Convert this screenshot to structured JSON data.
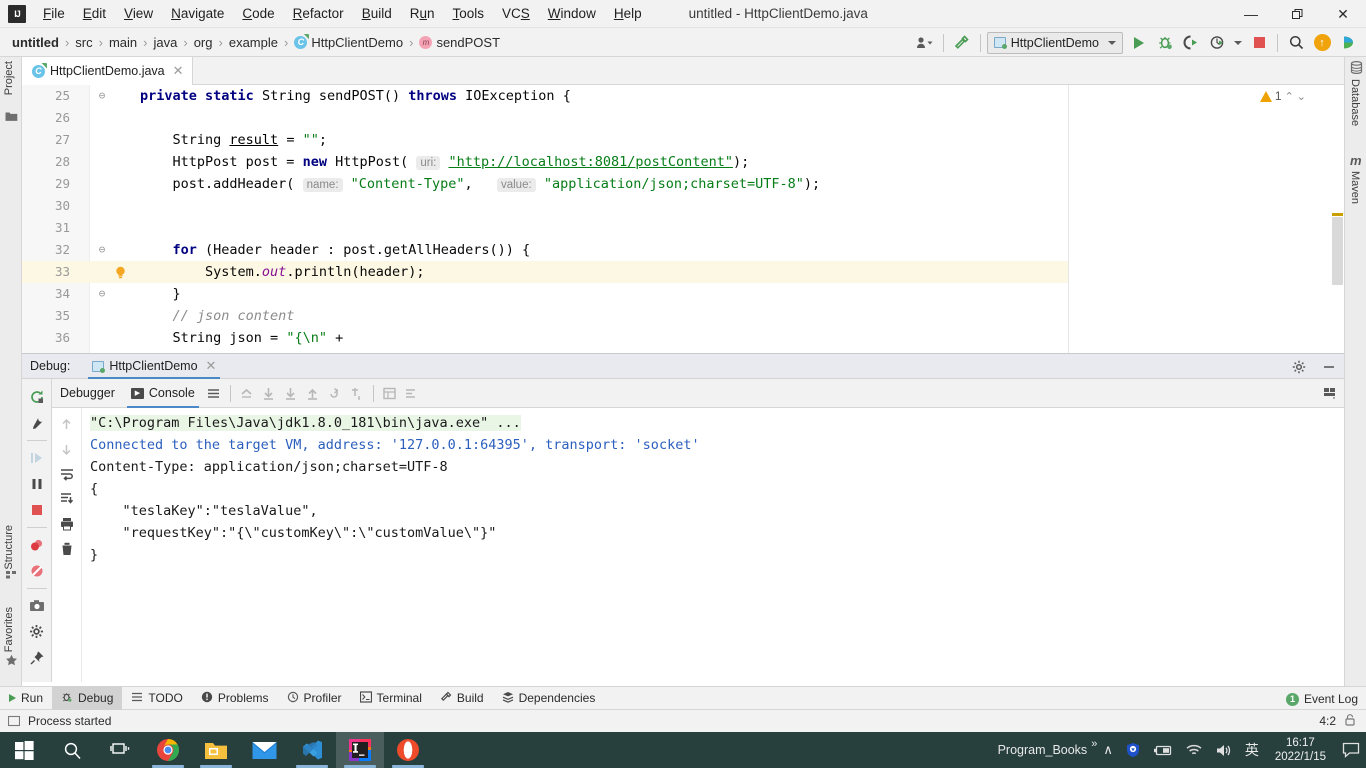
{
  "window": {
    "title": "untitled - HttpClientDemo.java",
    "minimize": "—",
    "maximize": "❐",
    "close": "✕"
  },
  "menu": {
    "items": [
      {
        "label": "File"
      },
      {
        "label": "Edit"
      },
      {
        "label": "View"
      },
      {
        "label": "Navigate"
      },
      {
        "label": "Code"
      },
      {
        "label": "Refactor"
      },
      {
        "label": "Build"
      },
      {
        "label": "Run"
      },
      {
        "label": "Tools"
      },
      {
        "label": "VCS"
      },
      {
        "label": "Window"
      },
      {
        "label": "Help"
      }
    ]
  },
  "navbar": {
    "crumbs": [
      {
        "label": "untitled"
      },
      {
        "label": "src"
      },
      {
        "label": "main"
      },
      {
        "label": "java"
      },
      {
        "label": "org"
      },
      {
        "label": "example"
      },
      {
        "label": "HttpClientDemo"
      },
      {
        "label": "sendPOST"
      }
    ],
    "separator": "›",
    "run_config": "HttpClientDemo",
    "icons": {
      "user": "user-settings-icon",
      "build": "hammer-icon",
      "run": "run-icon",
      "debug": "debug-icon",
      "coverage": "run-with-coverage-icon",
      "profile": "profiler-icon",
      "stop": "stop-icon",
      "search": "search-everywhere-icon",
      "update": "update-project-icon",
      "share": "share-icon"
    }
  },
  "left_stripe": {
    "project": "Project",
    "structure": "Structure",
    "favorites": "Favorites"
  },
  "right_stripe": {
    "database": "Database",
    "maven": "Maven"
  },
  "editor": {
    "tab": "HttpClientDemo.java",
    "tab_close": "✕",
    "warning_count": "1",
    "chevron_up": "⌃",
    "chevron_down": "⌄",
    "lines": [
      {
        "num": "25",
        "fold": "⊖",
        "segments": [
          {
            "t": "private ",
            "c": "kw"
          },
          {
            "t": "static ",
            "c": "kw"
          },
          {
            "t": "String sendPOST() ",
            "c": "plain"
          },
          {
            "t": "throws ",
            "c": "kw"
          },
          {
            "t": "IOException {",
            "c": "plain"
          }
        ]
      },
      {
        "num": "26",
        "fold": "",
        "segments": []
      },
      {
        "num": "27",
        "fold": "",
        "segments": [
          {
            "t": "    String ",
            "c": "plain"
          },
          {
            "t": "result",
            "c": "uline"
          },
          {
            "t": " = ",
            "c": "plain"
          },
          {
            "t": "\"\"",
            "c": "str"
          },
          {
            "t": ";",
            "c": "plain"
          }
        ]
      },
      {
        "num": "28",
        "fold": "",
        "segments": [
          {
            "t": "    HttpPost post = ",
            "c": "plain"
          },
          {
            "t": "new ",
            "c": "kw"
          },
          {
            "t": "HttpPost( ",
            "c": "plain"
          },
          {
            "t": "uri:",
            "c": "hint"
          },
          {
            "t": " ",
            "c": "plain"
          },
          {
            "t": "\"http://localhost:8081/postContent\"",
            "c": "strlink"
          },
          {
            "t": ");",
            "c": "plain"
          }
        ]
      },
      {
        "num": "29",
        "fold": "",
        "segments": [
          {
            "t": "    post.addHeader( ",
            "c": "plain"
          },
          {
            "t": "name:",
            "c": "hint"
          },
          {
            "t": " ",
            "c": "plain"
          },
          {
            "t": "\"Content-Type\"",
            "c": "str"
          },
          {
            "t": ",   ",
            "c": "plain"
          },
          {
            "t": "value:",
            "c": "hint"
          },
          {
            "t": " ",
            "c": "plain"
          },
          {
            "t": "\"application/json;charset=UTF-8\"",
            "c": "str"
          },
          {
            "t": ");",
            "c": "plain"
          }
        ]
      },
      {
        "num": "30",
        "fold": "",
        "segments": []
      },
      {
        "num": "31",
        "fold": "",
        "segments": []
      },
      {
        "num": "32",
        "fold": "⊖",
        "segments": [
          {
            "t": "    ",
            "c": "plain"
          },
          {
            "t": "for ",
            "c": "kw"
          },
          {
            "t": "(Header header : post.getAllHeaders()) {",
            "c": "plain"
          }
        ]
      },
      {
        "num": "33",
        "fold": "",
        "bulb": true,
        "highlight": true,
        "segments": [
          {
            "t": "        System.",
            "c": "plain"
          },
          {
            "t": "out",
            "c": "fld"
          },
          {
            "t": ".println(header);",
            "c": "plain"
          }
        ]
      },
      {
        "num": "34",
        "fold": "⊖",
        "segments": [
          {
            "t": "    }",
            "c": "plain"
          }
        ]
      },
      {
        "num": "35",
        "fold": "",
        "segments": [
          {
            "t": "    // json content",
            "c": "cmt"
          }
        ]
      },
      {
        "num": "36",
        "fold": "",
        "segments": [
          {
            "t": "    String json = ",
            "c": "plain"
          },
          {
            "t": "\"{\\n\"",
            "c": "str"
          },
          {
            "t": " +",
            "c": "plain"
          }
        ]
      }
    ]
  },
  "debug": {
    "panel_label": "Debug:",
    "session_tab": "HttpClientDemo",
    "session_close": "✕",
    "tabs": [
      {
        "label": "Debugger",
        "active": false
      },
      {
        "label": "Console",
        "active": true
      }
    ],
    "settings_icon": "gear-icon",
    "hide_icon": "hide-icon",
    "layout_icon": "layout-settings-icon",
    "side_icons": [
      "rerun-icon",
      "edit-configuration-icon",
      "resume-icon",
      "pause-icon",
      "stop-icon",
      "view-breakpoints-icon",
      "mute-breakpoints-icon",
      "screenshot-icon",
      "settings-icon",
      "pin-icon"
    ],
    "secondary_icons": [
      "scroll-up-icon",
      "scroll-down-icon",
      "soft-wrap-icon",
      "scroll-to-end-icon",
      "print-icon",
      "clear-all-icon"
    ],
    "stepping_icons": [
      "show-execution-point-icon",
      "step-over-icon",
      "step-into-icon",
      "force-step-into-icon",
      "step-out-icon",
      "drop-frame-icon",
      "run-to-cursor-icon",
      "evaluate-expression-icon",
      "layout-icon"
    ],
    "console_output": [
      {
        "text": "\"C:\\Program Files\\Java\\jdk1.8.0_181\\bin\\java.exe\" ...",
        "style": "o-cmd"
      },
      {
        "text": "Connected to the target VM, address: '127.0.0.1:64395', transport: 'socket'",
        "style": "o-info"
      },
      {
        "text": "Content-Type: application/json;charset=UTF-8",
        "style": "o-plain"
      },
      {
        "text": "{",
        "style": "o-plain"
      },
      {
        "text": "    \"teslaKey\":\"teslaValue\",",
        "style": "o-plain"
      },
      {
        "text": "    \"requestKey\":\"{\\\"customKey\\\":\\\"customValue\\\"}\"",
        "style": "o-plain"
      },
      {
        "text": "}",
        "style": "o-plain"
      }
    ]
  },
  "toolwindow_bar": {
    "items": [
      {
        "label": "Run",
        "icon": "run-icon",
        "active": false
      },
      {
        "label": "Debug",
        "icon": "debug-icon",
        "active": true
      },
      {
        "label": "TODO",
        "icon": "todo-icon",
        "active": false
      },
      {
        "label": "Problems",
        "icon": "problems-icon",
        "active": false
      },
      {
        "label": "Profiler",
        "icon": "profiler-icon",
        "active": false
      },
      {
        "label": "Terminal",
        "icon": "terminal-icon",
        "active": false
      },
      {
        "label": "Build",
        "icon": "build-icon",
        "active": false
      },
      {
        "label": "Dependencies",
        "icon": "dependencies-icon",
        "active": false
      }
    ],
    "event_log": "Event Log",
    "event_log_count": "1"
  },
  "statusbar": {
    "message": "Process started",
    "caret": "4:2",
    "lock_icon": "lock-icon"
  },
  "taskbar": {
    "start": "start-icon",
    "search": "search-icon",
    "taskview": "task-view-icon",
    "apps": [
      {
        "name": "chrome-icon",
        "running": true
      },
      {
        "name": "file-explorer-icon",
        "running": true
      },
      {
        "name": "mail-icon",
        "running": false
      },
      {
        "name": "vscode-icon",
        "running": true
      },
      {
        "name": "intellij-idea-icon",
        "running": true,
        "active": true
      },
      {
        "name": "opera-icon",
        "running": true
      }
    ],
    "tray_label": "Program_Books",
    "tray_overflow": "»",
    "tray_chevron": "∧",
    "tray_icons": [
      "shield-icon",
      "battery-icon",
      "wifi-icon",
      "volume-icon",
      "ime-icon"
    ],
    "time": "16:17",
    "date": "2022/1/15",
    "notifications": "notification-icon"
  },
  "colors": {
    "accent_blue": "#4a88c7",
    "keyword": "#000080",
    "string": "#067d17",
    "comment": "#8c8c8c",
    "field": "#871094",
    "run_green": "#499c54",
    "stop_red": "#e05252",
    "warning": "#eda200",
    "taskbar_bg": "#27403e",
    "highlight_line": "#fdf8e3"
  }
}
